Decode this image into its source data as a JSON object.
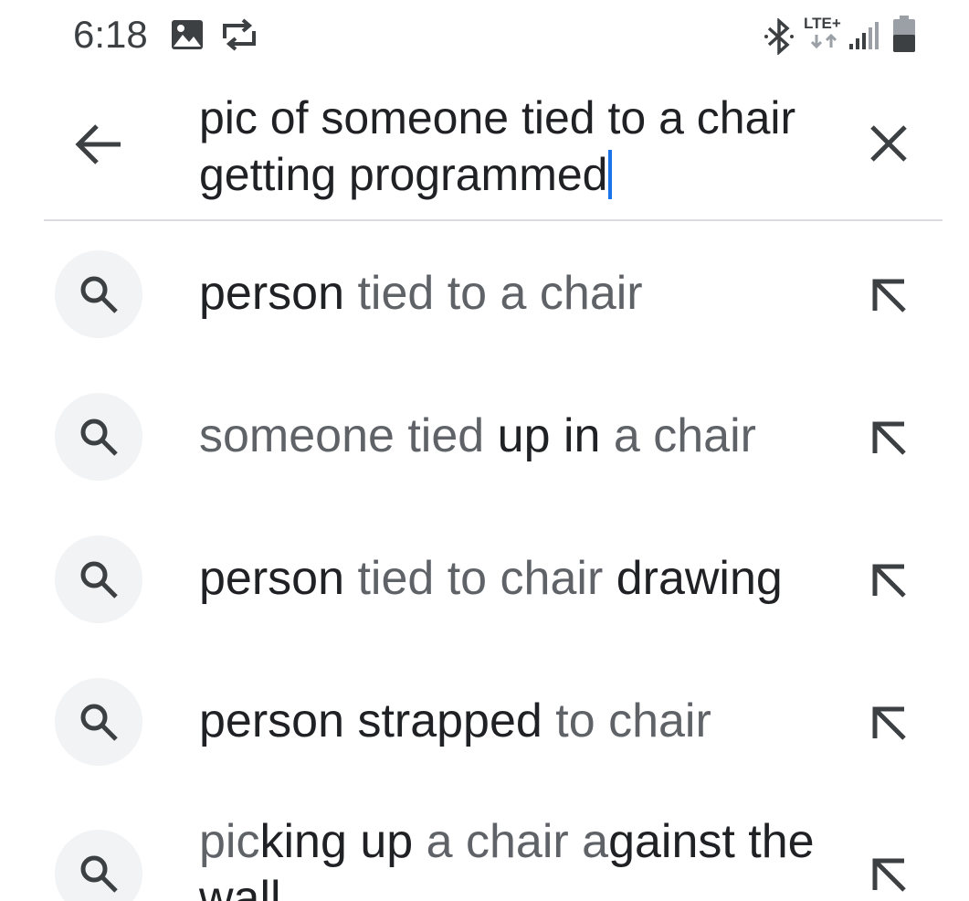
{
  "status_bar": {
    "time": "6:18",
    "network_label": "LTE+",
    "icons": [
      "image-icon",
      "sync-icon",
      "bluetooth-icon",
      "lte-icon",
      "signal-icon",
      "battery-icon"
    ]
  },
  "search": {
    "query": "pic of someone tied to a chair getting programmed",
    "back_icon": "arrow-left-icon",
    "clear_icon": "close-icon",
    "caret_color": "#1a73e8"
  },
  "suggestions": [
    {
      "parts": [
        {
          "t": "person",
          "bold": true
        },
        {
          "t": " tied to a chair",
          "bold": false
        }
      ]
    },
    {
      "parts": [
        {
          "t": "someone tied ",
          "bold": false
        },
        {
          "t": "up in",
          "bold": true
        },
        {
          "t": " a chair",
          "bold": false
        }
      ]
    },
    {
      "parts": [
        {
          "t": "person",
          "bold": true
        },
        {
          "t": " tied to chair ",
          "bold": false
        },
        {
          "t": "drawing",
          "bold": true
        }
      ]
    },
    {
      "parts": [
        {
          "t": "person strapped",
          "bold": true
        },
        {
          "t": " to chair",
          "bold": false
        }
      ]
    },
    {
      "parts": [
        {
          "t": "pic",
          "bold": false
        },
        {
          "t": "king up",
          "bold": true
        },
        {
          "t": " a chair a",
          "bold": false
        },
        {
          "t": "gainst the wall",
          "bold": true
        }
      ]
    }
  ],
  "colors": {
    "matched_text": "#5f6368",
    "added_text": "#202124",
    "icon_circle": "#f1f3f4",
    "divider": "#dadce0"
  }
}
